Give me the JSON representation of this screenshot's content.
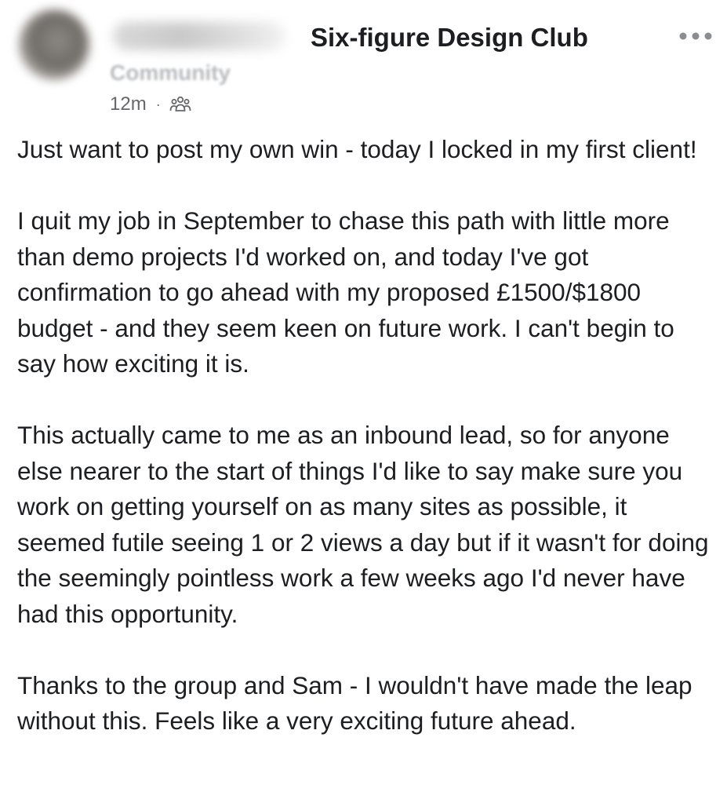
{
  "post": {
    "group_name": "Six-figure Design Club",
    "role_label": "Community",
    "timestamp": "12m",
    "separator": "·",
    "icons": {
      "more": "more-options-icon",
      "audience": "group-members-icon"
    },
    "paragraphs": [
      "Just want to post my own win - today I locked in my first client!",
      "I quit my job in September to chase this path with little more than demo projects I'd worked on, and today I've got confirmation to go ahead with my proposed £1500/$1800 budget - and they seem keen on future work. I can't begin to say how exciting it is.",
      "This actually came to me as an inbound lead, so for anyone else nearer to the start of things I'd like to say make sure you work on getting yourself on as many sites as possible, it seemed futile seeing 1 or 2 views a day but if it wasn't for doing the seemingly pointless work a few weeks ago I'd never have had this opportunity.",
      "Thanks to the group and Sam - I wouldn't have made the leap without this. Feels like a very exciting future ahead."
    ]
  }
}
